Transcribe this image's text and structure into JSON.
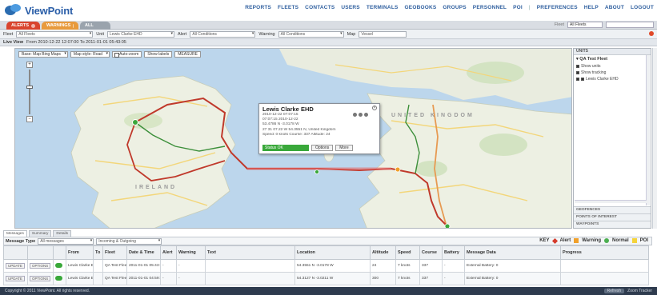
{
  "app": {
    "logo_text": "ViewPoint",
    "colors": {
      "brand": "#2a5ea8",
      "alert": "#d53a2a",
      "warning": "#f0a02a",
      "normal": "#4caf50",
      "poi": "#f5d33a",
      "route": "#c0392b"
    }
  },
  "topnav": [
    "REPORTS",
    "FLEETS",
    "CONTACTS",
    "USERS",
    "TERMINALS",
    "GEOBOOKS",
    "GROUPS",
    "PERSONNEL",
    "POI",
    "|",
    "PREFERENCES",
    "HELP",
    "ABOUT",
    "LOGOUT"
  ],
  "tabs": [
    "ALERTS",
    "WARNINGS",
    "ALL"
  ],
  "filters": {
    "fleet_label": "Fleet",
    "fleet_value": "All Fleets",
    "unit_label": "Unit",
    "unit_value": "Lewis Clarke EHD",
    "alert_label": "Alert",
    "alert_value": "All Conditions",
    "warning_label": "Warning",
    "warning_value": "All Conditions",
    "map_label": "Map",
    "map_value": "Vessel"
  },
  "livebar": {
    "label": "Live View",
    "range": "From 2010-12-22 12:07:00 To 2011-01-01 05:43:05"
  },
  "map": {
    "base_map": "Base: Map Bing Maps",
    "map_style": "Map style: Road",
    "autozoom": "Auto-zoom",
    "show_labels": "Show labels",
    "measure": "MEASURE",
    "zoom_in": "+",
    "zoom_out": "−",
    "labels": {
      "united_kingdom": "UNITED KINGDOM",
      "ireland": "IRELAND"
    }
  },
  "popup": {
    "title": "Lewis Clarke EHD",
    "lines": [
      "2010-12-22 07:07:15",
      "07:07:15 2010-12-22",
      "53.4786 N -3.0178 W",
      "27 31 07.22 W 54.3551 N, United Kingdom",
      "Speed: 0 knots Course: 337 Altitude: 24"
    ],
    "status": "Status OK",
    "options_button": "Options",
    "more_button": "More"
  },
  "right_panel": {
    "header": "UNITS",
    "group": "QA Test Fleet",
    "opt1": "Show units",
    "opt2": "Show tracking",
    "unit": "Lewis Clarke EHD",
    "accordion": [
      "GEOFENCES",
      "POINTS OF INTEREST",
      "WAYPOINTS"
    ]
  },
  "grid": {
    "tabs": [
      "Messages",
      "Summary",
      "Details"
    ],
    "messages_label": "Message Type",
    "type_value": "All messages",
    "direction_value": "Incoming & Outgoing",
    "key_label": "KEY",
    "key": [
      "Alert",
      "Warning",
      "Normal",
      "POI"
    ],
    "columns": [
      "",
      "",
      "",
      "From",
      "To",
      "Fleet",
      "Date & Time",
      "Alert",
      "Warning",
      "Text",
      "Location",
      "Altitude",
      "Speed",
      "Course",
      "Battery",
      "Message Data",
      "Progress"
    ],
    "rows": [
      [
        "UPDATE",
        "OPTIONS",
        "",
        "Lewis Clarke EHD",
        "",
        "QA Test Fleet",
        "2011-01-01 05:43:05",
        "-",
        "-",
        "",
        "54.3551 N -3.0178 W",
        "24",
        "7 knots",
        "337",
        "-",
        "External Battery: 0",
        ""
      ],
      [
        "UPDATE",
        "OPTIONS",
        "",
        "Lewis Clarke EHD",
        "",
        "QA Test Fleet",
        "2011-01-01 04:59:03",
        "-",
        "-",
        "",
        "54.3127 N -3.0211 W",
        "300",
        "7 knots",
        "337",
        "-",
        "External Battery: 0",
        ""
      ]
    ]
  },
  "statusbar": {
    "left": "Copyright © 2011 ViewPoint. All rights reserved.",
    "right": [
      "Refresh",
      "Zoom Tracker"
    ]
  }
}
